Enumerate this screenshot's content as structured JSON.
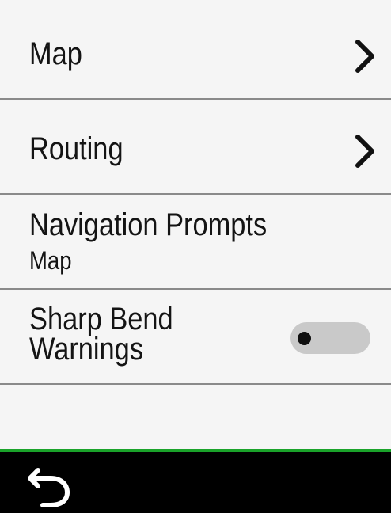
{
  "menu": {
    "items": [
      {
        "label": "Map",
        "has_chevron": true
      },
      {
        "label": "Routing",
        "has_chevron": true
      }
    ],
    "navigation_prompts": {
      "label": "Navigation Prompts",
      "value": "Map"
    },
    "sharp_bend_warnings": {
      "label": "Sharp Bend Warnings",
      "toggle_state": "off"
    }
  },
  "footer": {
    "back_icon": "back-arrow-icon",
    "accent_line_color": "#1aa32a"
  },
  "colors": {
    "background": "#f5f5f5",
    "text": "#141414",
    "divider": "#8a8a8a",
    "toggle_track": "#c9c9c9",
    "toggle_knob": "#0f0f0f",
    "footer": "#000000"
  }
}
